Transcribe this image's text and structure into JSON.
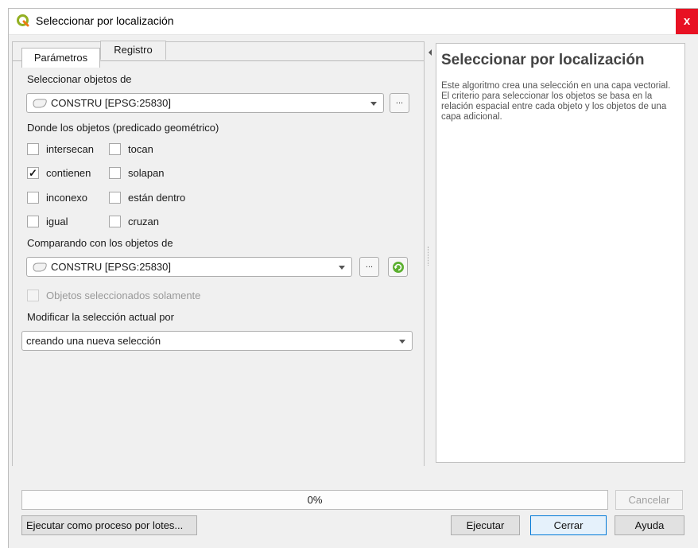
{
  "window": {
    "title": "Seleccionar por localización",
    "close_label": "x"
  },
  "tabs": [
    {
      "label": "Parámetros",
      "active": true
    },
    {
      "label": "Registro",
      "active": false
    }
  ],
  "params": {
    "input_label": "Seleccionar objetos de",
    "input_layer": "CONSTRU [EPSG:25830]",
    "predicate_label": "Donde los objetos (predicado geométrico)",
    "predicates": [
      {
        "label": "intersecan",
        "checked": false
      },
      {
        "label": "tocan",
        "checked": false
      },
      {
        "label": "contienen",
        "checked": true
      },
      {
        "label": "solapan",
        "checked": false
      },
      {
        "label": "inconexo",
        "checked": false
      },
      {
        "label": "están dentro",
        "checked": false
      },
      {
        "label": "igual",
        "checked": false
      },
      {
        "label": "cruzan",
        "checked": false
      }
    ],
    "intersect_label": "Comparando con los objetos de",
    "intersect_layer": "CONSTRU [EPSG:25830]",
    "selected_only_label": "Objetos seleccionados solamente",
    "method_label": "Modificar la selección actual por",
    "method_value": "creando una nueva selección",
    "browse_label": "..."
  },
  "help": {
    "title": "Seleccionar por localización",
    "body": "Este algoritmo crea una selección en una capa vectorial. El criterio para seleccionar los objetos se basa en la relación espacial entre cada objeto y los objetos de una capa adicional."
  },
  "progress": {
    "value": 0,
    "text": "0%"
  },
  "buttons": {
    "cancel": "Cancelar",
    "batch": "Ejecutar como proceso por lotes...",
    "run": "Ejecutar",
    "close": "Cerrar",
    "help": "Ayuda"
  },
  "colors": {
    "close_bg": "#e81123",
    "progress_fill": "#06b025",
    "default_button_border": "#0078d7"
  }
}
